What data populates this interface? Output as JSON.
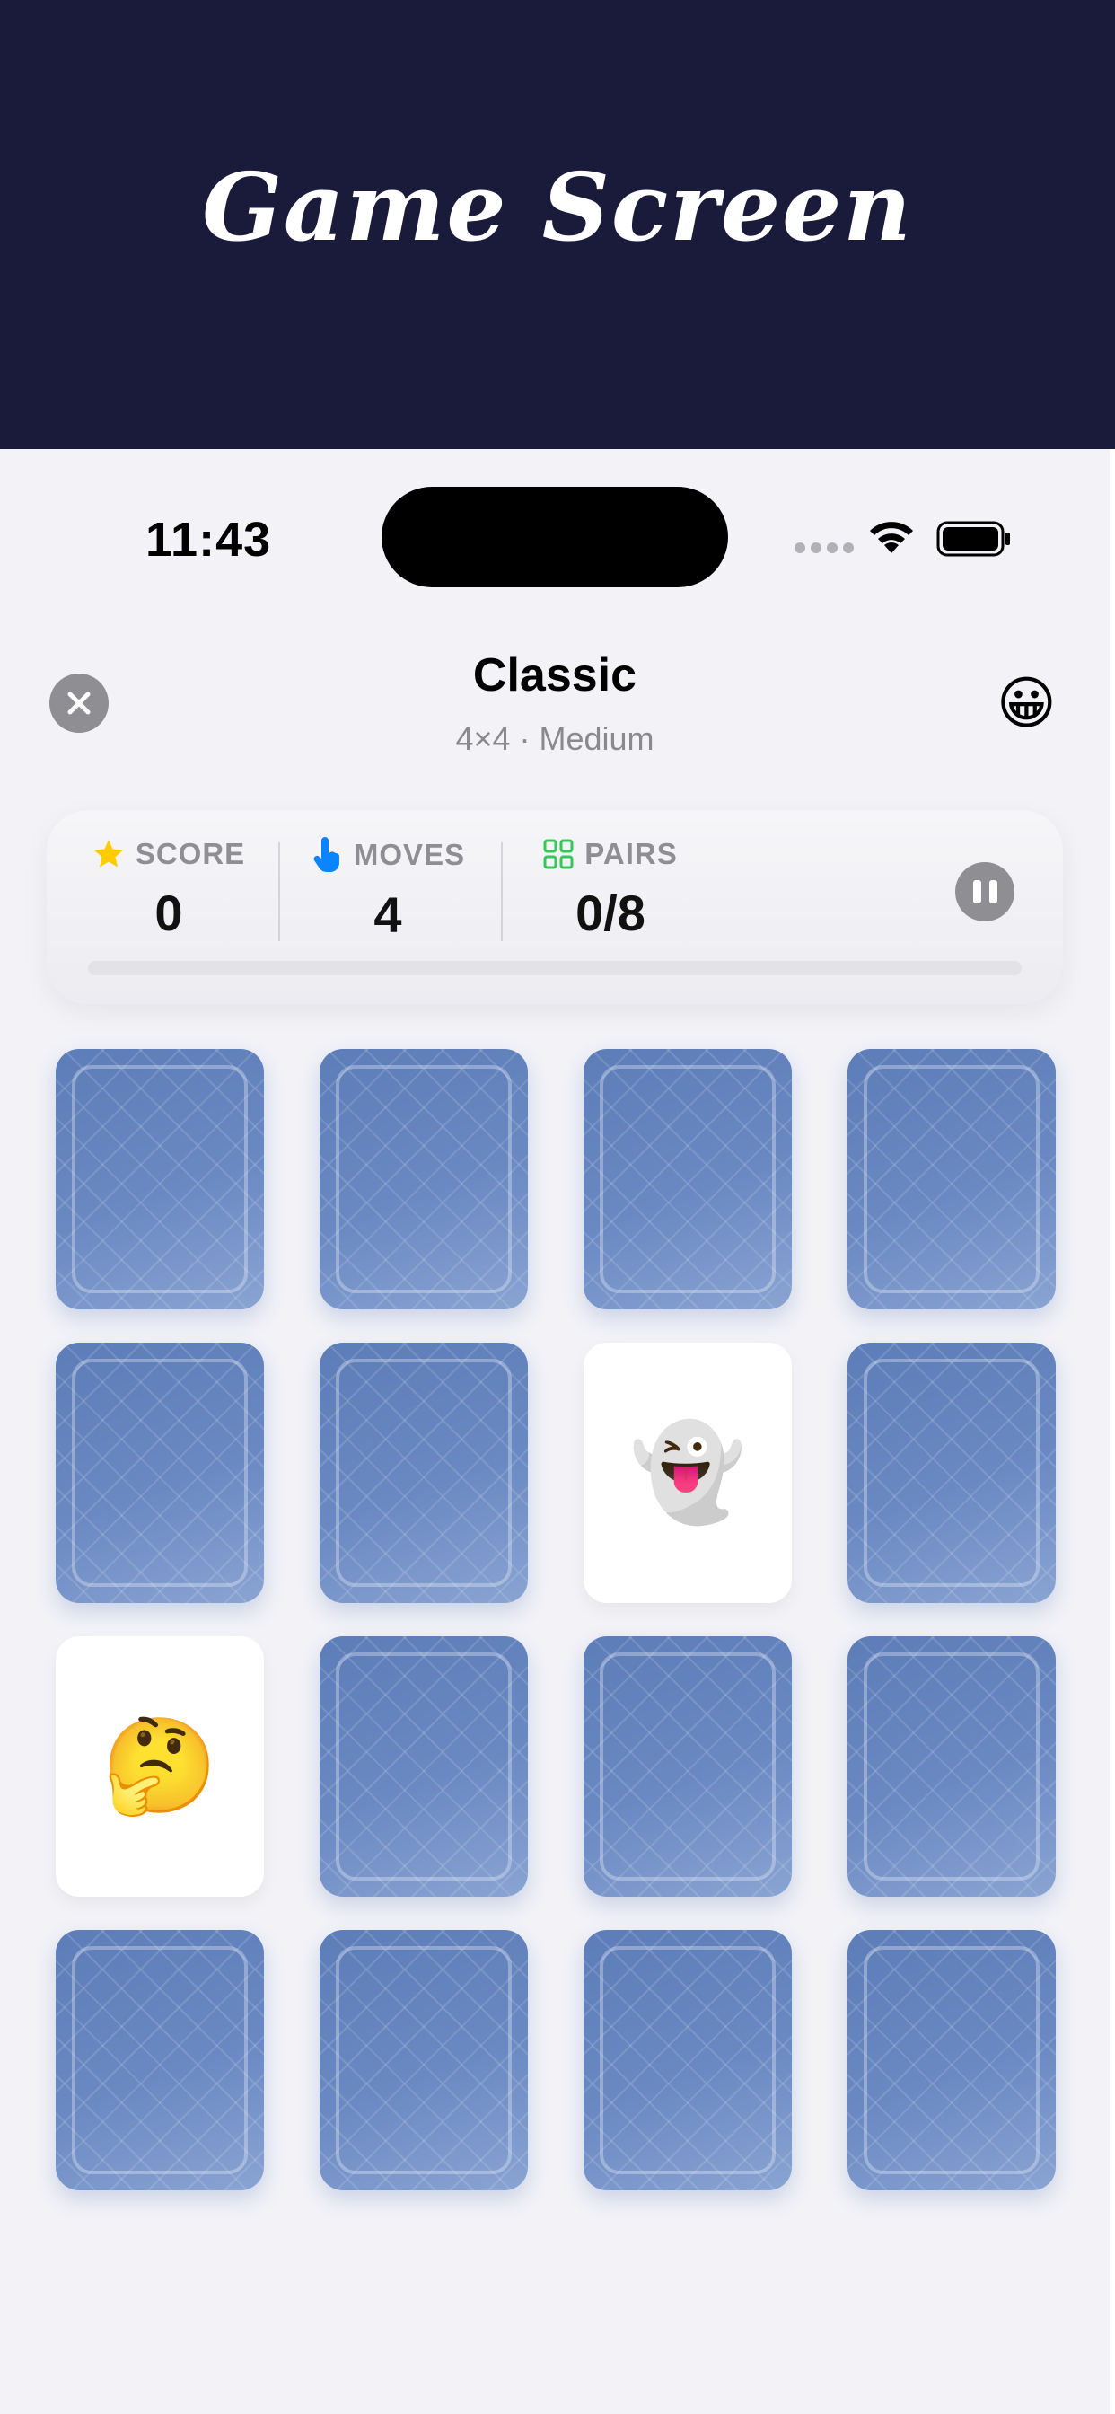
{
  "banner": {
    "title": "Game Screen"
  },
  "status_bar": {
    "time": "11:43"
  },
  "header": {
    "title": "Classic",
    "subtitle": "4×4 · Medium",
    "mood_emoji": "😀",
    "close_icon": "close-icon"
  },
  "stats": {
    "score": {
      "label": "SCORE",
      "value": "0",
      "icon": "star-icon",
      "icon_color": "#ffcc00"
    },
    "moves": {
      "label": "MOVES",
      "value": "4",
      "icon": "hand-tap-icon",
      "icon_color": "#0a84ff"
    },
    "pairs": {
      "label": "PAIRS",
      "value": "0/8",
      "icon": "grid-icon",
      "icon_color": "#34c759"
    },
    "progress": 0,
    "pause_icon": "pause-icon"
  },
  "board": {
    "rows": 4,
    "columns": 4,
    "cards": [
      {
        "state": "hidden",
        "emoji": ""
      },
      {
        "state": "hidden",
        "emoji": ""
      },
      {
        "state": "hidden",
        "emoji": ""
      },
      {
        "state": "hidden",
        "emoji": ""
      },
      {
        "state": "hidden",
        "emoji": ""
      },
      {
        "state": "hidden",
        "emoji": ""
      },
      {
        "state": "revealed",
        "emoji": "👻"
      },
      {
        "state": "hidden",
        "emoji": ""
      },
      {
        "state": "revealed",
        "emoji": "🤔"
      },
      {
        "state": "hidden",
        "emoji": ""
      },
      {
        "state": "hidden",
        "emoji": ""
      },
      {
        "state": "hidden",
        "emoji": ""
      },
      {
        "state": "hidden",
        "emoji": ""
      },
      {
        "state": "hidden",
        "emoji": ""
      },
      {
        "state": "hidden",
        "emoji": ""
      },
      {
        "state": "hidden",
        "emoji": ""
      }
    ]
  },
  "colors": {
    "banner_bg": "#1a1a3b",
    "card_back": "#6a89c3",
    "background": "#f2f2f7"
  }
}
